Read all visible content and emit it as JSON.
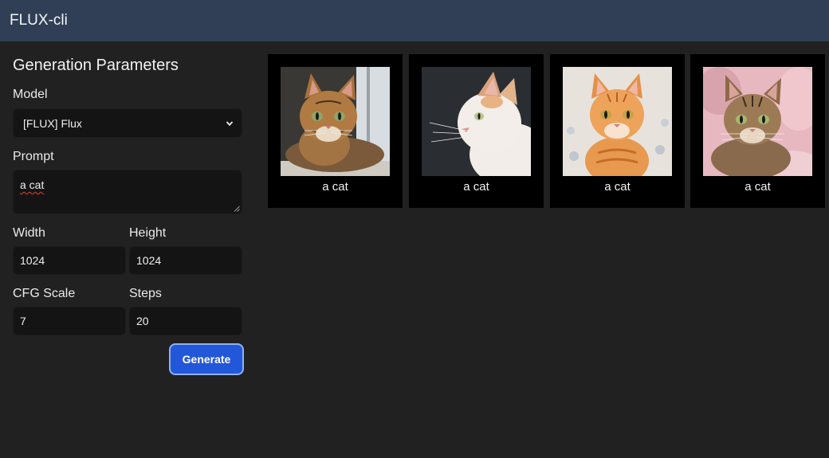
{
  "app": {
    "title": "FLUX-cli"
  },
  "sidebar": {
    "section_title": "Generation Parameters",
    "model": {
      "label": "Model",
      "selected": "[FLUX] Flux"
    },
    "prompt": {
      "label": "Prompt",
      "value": "a cat"
    },
    "width": {
      "label": "Width",
      "value": "1024"
    },
    "height": {
      "label": "Height",
      "value": "1024"
    },
    "cfg_scale": {
      "label": "CFG Scale",
      "value": "7"
    },
    "steps": {
      "label": "Steps",
      "value": "20"
    },
    "generate_label": "Generate"
  },
  "gallery": {
    "items": [
      {
        "caption": "a cat"
      },
      {
        "caption": "a cat"
      },
      {
        "caption": "a cat"
      },
      {
        "caption": "a cat"
      }
    ]
  },
  "colors": {
    "topbar": "#303f55",
    "background": "#212121",
    "accent": "#2357d9"
  }
}
